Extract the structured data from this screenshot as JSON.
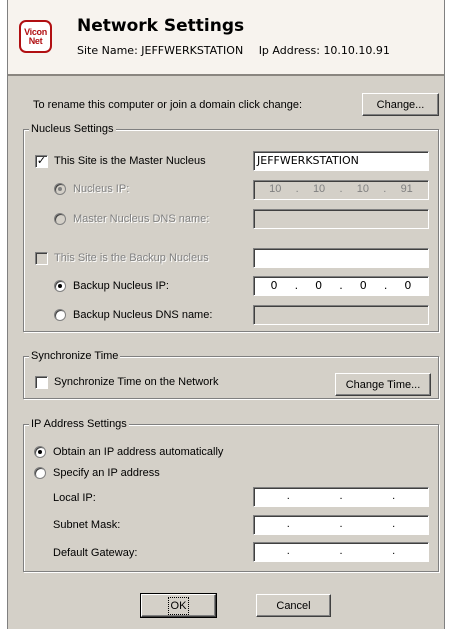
{
  "header": {
    "logo_line1": "Vicon",
    "logo_line2": "Net",
    "title": "Network Settings",
    "site_name_label": "Site Name:",
    "site_name": "JEFFWERKSTATION",
    "ip_label": "Ip Address:",
    "ip": "10.10.10.91"
  },
  "rename": {
    "text": "To rename this computer or join a domain click change:",
    "button": "Change..."
  },
  "nucleus": {
    "legend": "Nucleus Settings",
    "master_label": "This Site is the Master Nucleus",
    "master_checked": true,
    "master_value": "JEFFWERKSTATION",
    "nucleus_ip_label": "Nucleus IP:",
    "nucleus_ip": [
      "10",
      "10",
      "10",
      "91"
    ],
    "master_dns_label": "Master Nucleus DNS name:",
    "backup_label": "This Site is the Backup Nucleus",
    "backup_checked": false,
    "backup_ip_label": "Backup Nucleus IP:",
    "backup_ip": [
      "0",
      "0",
      "0",
      "0"
    ],
    "backup_dns_label": "Backup Nucleus DNS name:"
  },
  "sync": {
    "legend": "Synchronize Time",
    "checkbox_label": "Synchronize Time on the Network",
    "checked": false,
    "button": "Change Time..."
  },
  "ip_settings": {
    "legend": "IP Address Settings",
    "auto_label": "Obtain an IP address automatically",
    "manual_label": "Specify an IP address",
    "local_ip_label": "Local IP:",
    "subnet_label": "Subnet Mask:",
    "gateway_label": "Default Gateway:",
    "ip_dots": [
      ".",
      ".",
      "."
    ]
  },
  "footer": {
    "ok": "OK",
    "cancel": "Cancel"
  }
}
